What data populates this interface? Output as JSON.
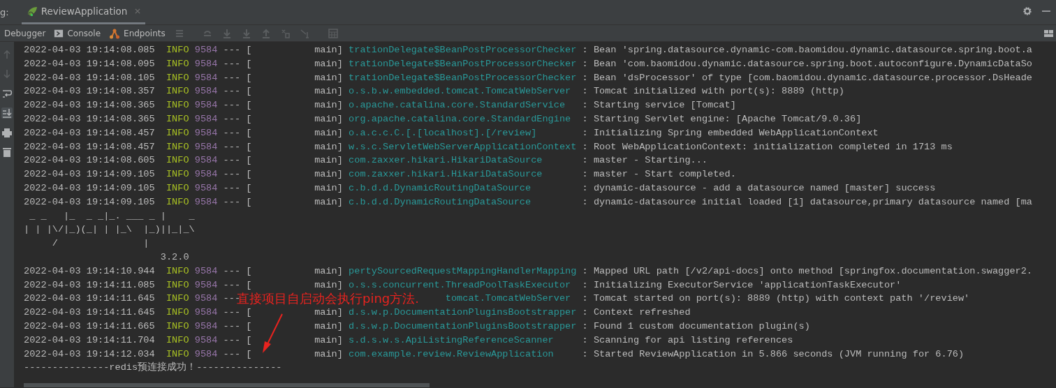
{
  "header": {
    "label": "g:",
    "tabs": [
      {
        "label": "ReviewApplication",
        "selected": true
      }
    ]
  },
  "toolbar": {
    "items": [
      {
        "label": "Debugger",
        "kind": "plain"
      },
      {
        "label": "Console",
        "kind": "console"
      },
      {
        "label": "Endpoints",
        "kind": "endpoints"
      }
    ]
  },
  "console": {
    "lines": [
      {
        "kind": "log",
        "timestamp": "2022-04-03 19:14:08.085",
        "level": "INFO",
        "pid": "9584",
        "separator": "---",
        "thread": "[           main]",
        "logger": "trationDelegate$BeanPostProcessorChecker",
        "message": ": Bean 'spring.datasource.dynamic-com.baomidou.dynamic.datasource.spring.boot.a"
      },
      {
        "kind": "log",
        "timestamp": "2022-04-03 19:14:08.095",
        "level": "INFO",
        "pid": "9584",
        "separator": "---",
        "thread": "[           main]",
        "logger": "trationDelegate$BeanPostProcessorChecker",
        "message": ": Bean 'com.baomidou.dynamic.datasource.spring.boot.autoconfigure.DynamicDataSo"
      },
      {
        "kind": "log",
        "timestamp": "2022-04-03 19:14:08.105",
        "level": "INFO",
        "pid": "9584",
        "separator": "---",
        "thread": "[           main]",
        "logger": "trationDelegate$BeanPostProcessorChecker",
        "message": ": Bean 'dsProcessor' of type [com.baomidou.dynamic.datasource.processor.DsHeade"
      },
      {
        "kind": "log",
        "timestamp": "2022-04-03 19:14:08.357",
        "level": "INFO",
        "pid": "9584",
        "separator": "---",
        "thread": "[           main]",
        "logger": "o.s.b.w.embedded.tomcat.TomcatWebServer",
        "message": ": Tomcat initialized with port(s): 8889 (http)"
      },
      {
        "kind": "log",
        "timestamp": "2022-04-03 19:14:08.365",
        "level": "INFO",
        "pid": "9584",
        "separator": "---",
        "thread": "[           main]",
        "logger": "o.apache.catalina.core.StandardService",
        "message": ": Starting service [Tomcat]"
      },
      {
        "kind": "log",
        "timestamp": "2022-04-03 19:14:08.365",
        "level": "INFO",
        "pid": "9584",
        "separator": "---",
        "thread": "[           main]",
        "logger": "org.apache.catalina.core.StandardEngine",
        "message": ": Starting Servlet engine: [Apache Tomcat/9.0.36]"
      },
      {
        "kind": "log",
        "timestamp": "2022-04-03 19:14:08.457",
        "level": "INFO",
        "pid": "9584",
        "separator": "---",
        "thread": "[           main]",
        "logger": "o.a.c.c.C.[.[localhost].[/review]",
        "message": ": Initializing Spring embedded WebApplicationContext"
      },
      {
        "kind": "log",
        "timestamp": "2022-04-03 19:14:08.457",
        "level": "INFO",
        "pid": "9584",
        "separator": "---",
        "thread": "[           main]",
        "logger": "w.s.c.ServletWebServerApplicationContext",
        "message": ": Root WebApplicationContext: initialization completed in 1713 ms"
      },
      {
        "kind": "log",
        "timestamp": "2022-04-03 19:14:08.605",
        "level": "INFO",
        "pid": "9584",
        "separator": "---",
        "thread": "[           main]",
        "logger": "com.zaxxer.hikari.HikariDataSource",
        "message": ": master - Starting..."
      },
      {
        "kind": "log",
        "timestamp": "2022-04-03 19:14:09.105",
        "level": "INFO",
        "pid": "9584",
        "separator": "---",
        "thread": "[           main]",
        "logger": "com.zaxxer.hikari.HikariDataSource",
        "message": ": master - Start completed."
      },
      {
        "kind": "log",
        "timestamp": "2022-04-03 19:14:09.105",
        "level": "INFO",
        "pid": "9584",
        "separator": "---",
        "thread": "[           main]",
        "logger": "c.b.d.d.DynamicRoutingDataSource",
        "message": ": dynamic-datasource - add a datasource named [master] success"
      },
      {
        "kind": "log",
        "timestamp": "2022-04-03 19:14:09.105",
        "level": "INFO",
        "pid": "9584",
        "separator": "---",
        "thread": "[           main]",
        "logger": "c.b.d.d.DynamicRoutingDataSource",
        "message": ": dynamic-datasource initial loaded [1] datasource,primary datasource named [ma"
      },
      {
        "kind": "banner",
        "text": " _ _   |_  _ _|_. ___ _ |    _"
      },
      {
        "kind": "banner",
        "text": "| | |\\/|_)(_| | |_\\  |_)||_|_\\"
      },
      {
        "kind": "banner",
        "text": "     /               |"
      },
      {
        "kind": "banner",
        "text": "                        3.2.0"
      },
      {
        "kind": "log",
        "timestamp": "2022-04-03 19:14:10.944",
        "level": "INFO",
        "pid": "9584",
        "separator": "---",
        "thread": "[           main]",
        "logger": "pertySourcedRequestMappingHandlerMapping",
        "message": ": Mapped URL path [/v2/api-docs] onto method [springfox.documentation.swagger2."
      },
      {
        "kind": "log",
        "timestamp": "2022-04-03 19:14:11.085",
        "level": "INFO",
        "pid": "9584",
        "separator": "---",
        "thread": "[           main]",
        "logger": "o.s.s.concurrent.ThreadPoolTaskExecutor",
        "message": ": Initializing ExecutorService 'applicationTaskExecutor'"
      },
      {
        "kind": "covered",
        "timestamp": "2022-04-03 19:14:11.645",
        "level": "INFO",
        "pid": "9584",
        "separator": "---",
        "logger": "tomcat.TomcatWebServer",
        "message": ": Tomcat started on port(s): 8889 (http) with context path '/review'"
      },
      {
        "kind": "log",
        "timestamp": "2022-04-03 19:14:11.645",
        "level": "INFO",
        "pid": "9584",
        "separator": "---",
        "thread": "[           main]",
        "logger": "d.s.w.p.DocumentationPluginsBootstrapper",
        "message": ": Context refreshed"
      },
      {
        "kind": "log",
        "timestamp": "2022-04-03 19:14:11.665",
        "level": "INFO",
        "pid": "9584",
        "separator": "---",
        "thread": "[           main]",
        "logger": "d.s.w.p.DocumentationPluginsBootstrapper",
        "message": ": Found 1 custom documentation plugin(s)"
      },
      {
        "kind": "log",
        "timestamp": "2022-04-03 19:14:11.704",
        "level": "INFO",
        "pid": "9584",
        "separator": "---",
        "thread": "[           main]",
        "logger": "s.d.s.w.s.ApiListingReferenceScanner",
        "message": ": Scanning for api listing references"
      },
      {
        "kind": "log",
        "timestamp": "2022-04-03 19:14:12.034",
        "level": "INFO",
        "pid": "9584",
        "separator": "---",
        "thread": "[           main]",
        "logger": "com.example.review.ReviewApplication",
        "message": ": Started ReviewApplication in 5.866 seconds (JVM running for 6.76)"
      },
      {
        "kind": "text",
        "text": "---------------redis预连接成功！---------------"
      }
    ]
  },
  "annotation": {
    "text": "直接项目自启动会执行ping方法."
  }
}
